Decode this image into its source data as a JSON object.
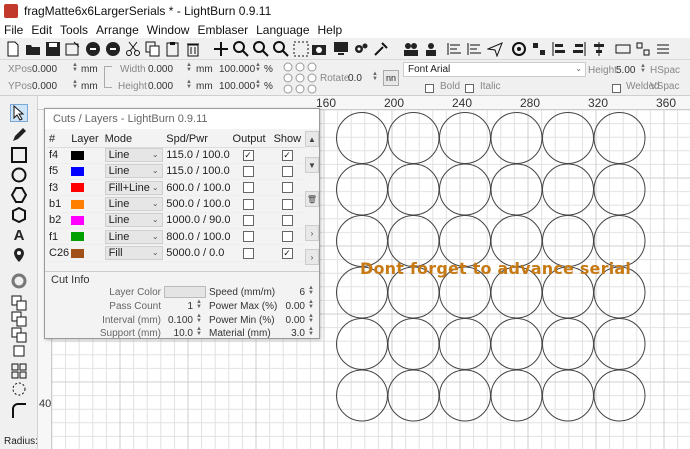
{
  "window": {
    "title": "fragMatte6x6LargerSerials * - LightBurn 0.9.11"
  },
  "menu": [
    "File",
    "Edit",
    "Tools",
    "Arrange",
    "Window",
    "Emblaser",
    "Language",
    "Help"
  ],
  "props": {
    "xpos_label": "XPos",
    "xpos_value": "0.000",
    "ypos_label": "YPos",
    "ypos_value": "0.000",
    "unit_mm": "mm",
    "width_label": "Width",
    "width_value": "0.000",
    "height_label": "Height",
    "height_value": "0.000",
    "scale_w": "100.000",
    "scale_h": "100.000",
    "pct": "%",
    "rotate_label": "Rotate",
    "rotate_value": "0.0",
    "nn_label": "nn",
    "font_value": "Font Arial",
    "font_height_label": "Height",
    "font_height_value": "5.00",
    "hspace_label": "HSpac",
    "vspace_label": "VSpac",
    "bold_label": "Bold",
    "italic_label": "Italic",
    "welded_label": "Welded"
  },
  "rulers": {
    "top": [
      "160",
      "200",
      "240",
      "280",
      "320",
      "360"
    ],
    "left": [
      "40"
    ]
  },
  "left_tools": {
    "radius_label": "Radius:"
  },
  "canvas_text": {
    "annotation": "Dont forget to advance serial",
    "annotation_color": "#c77a14"
  },
  "cuts_panel": {
    "title": "Cuts / Layers - LightBurn 0.9.11",
    "headers": [
      "#",
      "Layer",
      "Mode",
      "Spd/Pwr",
      "Output",
      "Show"
    ],
    "rows": [
      {
        "num": "f4",
        "color": "#000000",
        "mode": "Line",
        "spdpwr": "115.0 / 100.0",
        "output": true,
        "show": true
      },
      {
        "num": "f5",
        "color": "#0000ff",
        "mode": "Line",
        "spdpwr": "115.0 / 100.0",
        "output": false,
        "show": false
      },
      {
        "num": "f3",
        "color": "#ff0000",
        "mode": "Fill+Line",
        "spdpwr": "600.0 / 100.0",
        "output": false,
        "show": false
      },
      {
        "num": "b1",
        "color": "#ff8000",
        "mode": "Line",
        "spdpwr": "500.0 / 100.0",
        "output": false,
        "show": false
      },
      {
        "num": "b2",
        "color": "#ff00ff",
        "mode": "Line",
        "spdpwr": "1000.0 / 90.0",
        "output": false,
        "show": false
      },
      {
        "num": "f1",
        "color": "#00a000",
        "mode": "Line",
        "spdpwr": "800.0 / 100.0",
        "output": false,
        "show": false
      },
      {
        "num": "C26",
        "color": "#a0521a",
        "mode": "Fill",
        "spdpwr": "5000.0 / 0.0",
        "output": false,
        "show": true
      }
    ],
    "cut_info": {
      "heading": "Cut Info",
      "layer_color_label": "Layer Color",
      "pass_count_label": "Pass Count",
      "pass_count_value": "1",
      "interval_label": "Interval (mm)",
      "interval_value": "0.100",
      "support_label": "Support (mm)",
      "support_value": "10.0",
      "speed_label": "Speed (mm/m)",
      "speed_value": "6",
      "power_max_label": "Power Max (%)",
      "power_max_value": "0.00",
      "power_min_label": "Power Min (%)",
      "power_min_value": "0.00",
      "material_label": "Material (mm)",
      "material_value": "3.0"
    }
  }
}
